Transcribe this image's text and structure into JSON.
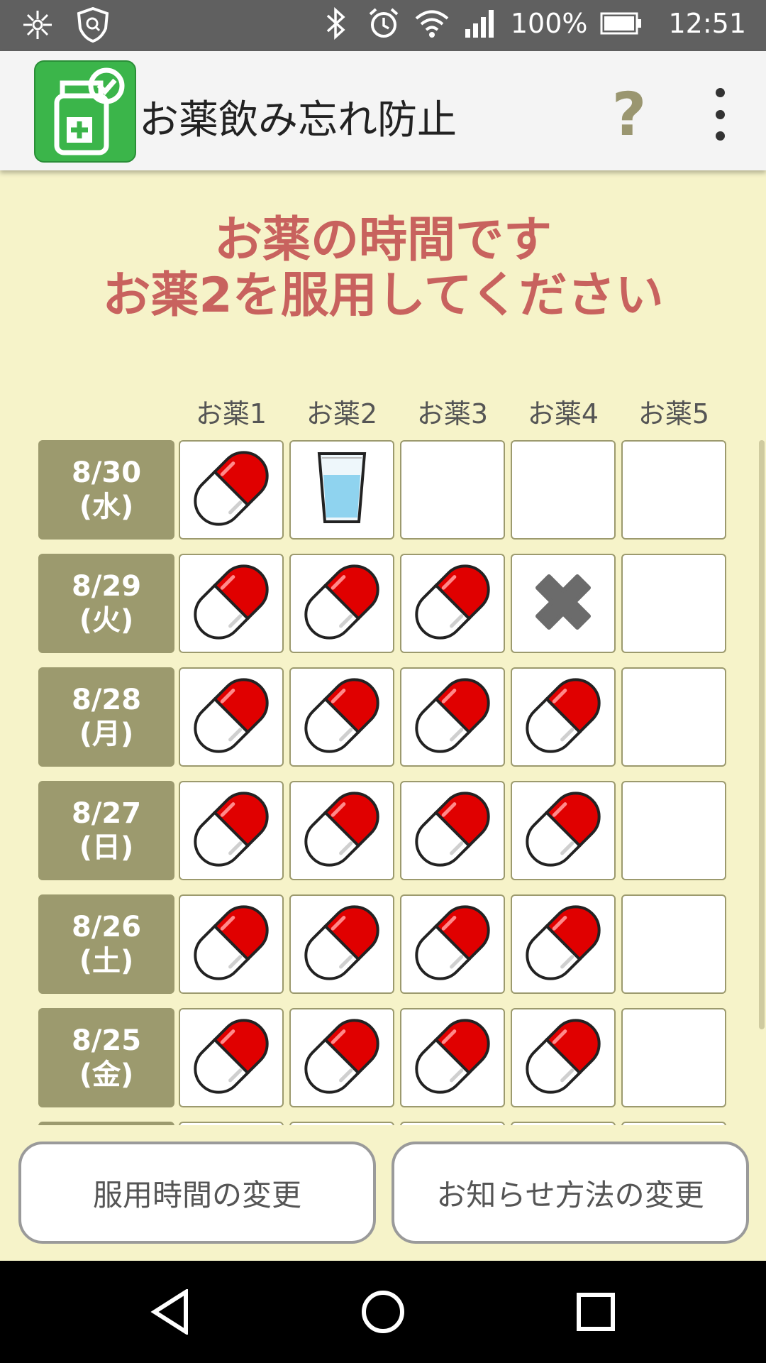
{
  "status_bar": {
    "battery": "100%",
    "time": "12:51",
    "icons": [
      "network-icon",
      "shield-icon",
      "bluetooth-icon",
      "alarm-icon",
      "wifi-icon",
      "signal-icon",
      "battery-icon"
    ]
  },
  "app_bar": {
    "title": "お薬飲み忘れ防止",
    "logo_icon": "medicine-bottle-check-icon",
    "help_label": "?",
    "menu_icon": "more-vert-icon"
  },
  "message": {
    "line1": "お薬の時間です",
    "line2": "お薬2を服用してください"
  },
  "columns": [
    "お薬1",
    "お薬2",
    "お薬3",
    "お薬4",
    "お薬5"
  ],
  "rows": [
    {
      "date": "8/30",
      "weekday": "(水)",
      "cells": [
        "pill",
        "glass",
        "empty",
        "empty",
        "empty"
      ]
    },
    {
      "date": "8/29",
      "weekday": "(火)",
      "cells": [
        "pill",
        "pill",
        "pill",
        "missed",
        "empty"
      ]
    },
    {
      "date": "8/28",
      "weekday": "(月)",
      "cells": [
        "pill",
        "pill",
        "pill",
        "pill",
        "empty"
      ]
    },
    {
      "date": "8/27",
      "weekday": "(日)",
      "cells": [
        "pill",
        "pill",
        "pill",
        "pill",
        "empty"
      ]
    },
    {
      "date": "8/26",
      "weekday": "(土)",
      "cells": [
        "pill",
        "pill",
        "pill",
        "pill",
        "empty"
      ]
    },
    {
      "date": "8/25",
      "weekday": "(金)",
      "cells": [
        "pill",
        "pill",
        "pill",
        "pill",
        "empty"
      ]
    }
  ],
  "buttons": {
    "change_time": "服用時間の変更",
    "change_notify": "お知らせ方法の変更"
  },
  "colors": {
    "background": "#F6F3C9",
    "accent_text": "#C8625E",
    "date_cell": "#9C9A6E",
    "logo": "#3BB54A",
    "pill_red": "#E00000"
  }
}
